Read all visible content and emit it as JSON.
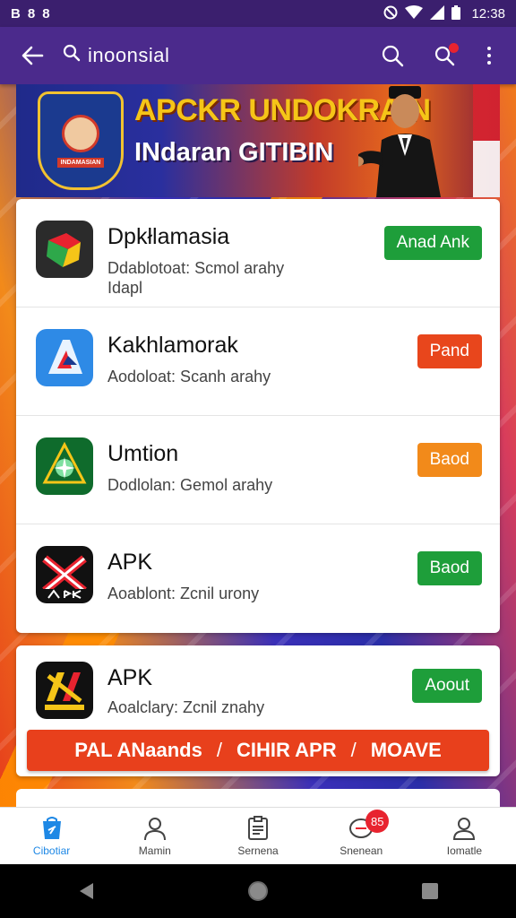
{
  "status_bar": {
    "left_icons": [
      "B",
      "8",
      "8"
    ],
    "time": "12:38"
  },
  "app_bar": {
    "search_text": "inoonsial"
  },
  "banner": {
    "title": "APCKR UNDOKRAIN",
    "subtitle": "INdaran GITIBIN",
    "badge_text": "INDAMASIAN"
  },
  "apps": [
    {
      "name": "Dpkłlamasia",
      "desc": "Ddablotoat: Scmol arahy Idapl",
      "button": "Anad Ank",
      "button_color": "#1e9e3a"
    },
    {
      "name": "Kakhlamorak",
      "desc": "Aodoloat: Scanh arahy",
      "button": "Pand",
      "button_color": "#e8461c"
    },
    {
      "name": "Umtion",
      "desc": "Dodlolan: Gemol arahy",
      "button": "Baod",
      "button_color": "#f28a1a"
    },
    {
      "name": "APK",
      "desc": "Aoablont: Zcnil urony",
      "button": "Baod",
      "button_color": "#1e9e3a"
    },
    {
      "name": "APK",
      "desc": "Aoalclary: Zcnil znahy",
      "button": "Aoout",
      "button_color": "#1e9e3a"
    }
  ],
  "promo": {
    "part1": "PAL ANaands",
    "sep1": "/",
    "part2": "CIHIR APR",
    "sep2": "/",
    "part3": "MOAVE"
  },
  "bottom_nav": [
    {
      "label": "Cibotiar",
      "icon": "store-icon",
      "active": true
    },
    {
      "label": "Mamin",
      "icon": "person-icon",
      "active": false
    },
    {
      "label": "Sernena",
      "icon": "document-icon",
      "active": false
    },
    {
      "label": "Snenean",
      "icon": "chat-icon",
      "active": false,
      "badge": "85"
    },
    {
      "label": "Iomatle",
      "icon": "profile-icon",
      "active": false
    }
  ],
  "colors": {
    "status_bar": "#3b1f6e",
    "app_bar": "#4b2a8c",
    "green": "#1e9e3a",
    "red": "#e8461c",
    "orange": "#f28a1a",
    "nav_active": "#1e88e5"
  }
}
